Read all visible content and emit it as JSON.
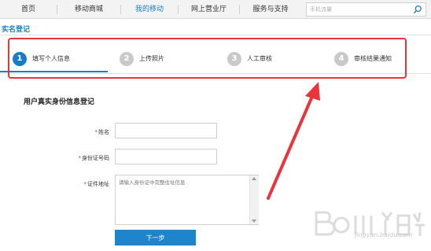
{
  "nav": {
    "items": [
      {
        "label": "首页"
      },
      {
        "label": "移动商城"
      },
      {
        "label": "我的移动",
        "active": true
      },
      {
        "label": "网上营业厅"
      },
      {
        "label": "服务与支持"
      }
    ],
    "search_placeholder": "手机流量"
  },
  "page": {
    "title": "实名登记"
  },
  "steps": [
    {
      "num": "1",
      "label": "填写个人信息",
      "active": true
    },
    {
      "num": "2",
      "label": "上传照片"
    },
    {
      "num": "3",
      "label": "人工审核"
    },
    {
      "num": "4",
      "label": "审核结果通知"
    }
  ],
  "form": {
    "title": "用户真实身份信息登记",
    "required_mark": "*",
    "name_label": "姓名",
    "id_label": "身份证号码",
    "address_label": "证件地址",
    "address_placeholder": "请输入身份证中完整住址信息",
    "next_label": "下一步"
  },
  "watermark": {
    "text": "jingyan.baidu.com"
  },
  "colors": {
    "accent": "#1a7dc4",
    "annotation": "#e8343a"
  }
}
